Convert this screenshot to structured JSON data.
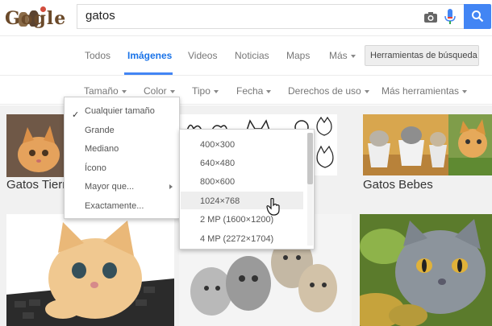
{
  "header": {
    "logo_text": "Gogle",
    "search_query": "gatos"
  },
  "nav": {
    "tabs": [
      "Todos",
      "Imágenes",
      "Videos",
      "Noticias",
      "Maps",
      "Más"
    ],
    "active": "Imágenes",
    "tools_button": "Herramientas de búsqueda"
  },
  "filters": {
    "items": [
      "Tamaño",
      "Color",
      "Tipo",
      "Fecha",
      "Derechos de uso",
      "Más herramientas"
    ]
  },
  "size_menu": {
    "items": [
      "Cualquier tamaño",
      "Grande",
      "Mediano",
      "Ícono",
      "Mayor que...",
      "Exactamente..."
    ],
    "checked": "Cualquier tamaño"
  },
  "larger_than_menu": {
    "items": [
      "400×300",
      "640×480",
      "800×600",
      "1024×768",
      "2 MP (1600×1200)",
      "4 MP (2272×1704)"
    ],
    "hovered": "1024×768"
  },
  "results": {
    "captions": [
      "Gatos Tierr",
      "Gatos Bebes"
    ]
  },
  "colors": {
    "accent": "#4285f4",
    "active_tab": "#1a73e8"
  }
}
